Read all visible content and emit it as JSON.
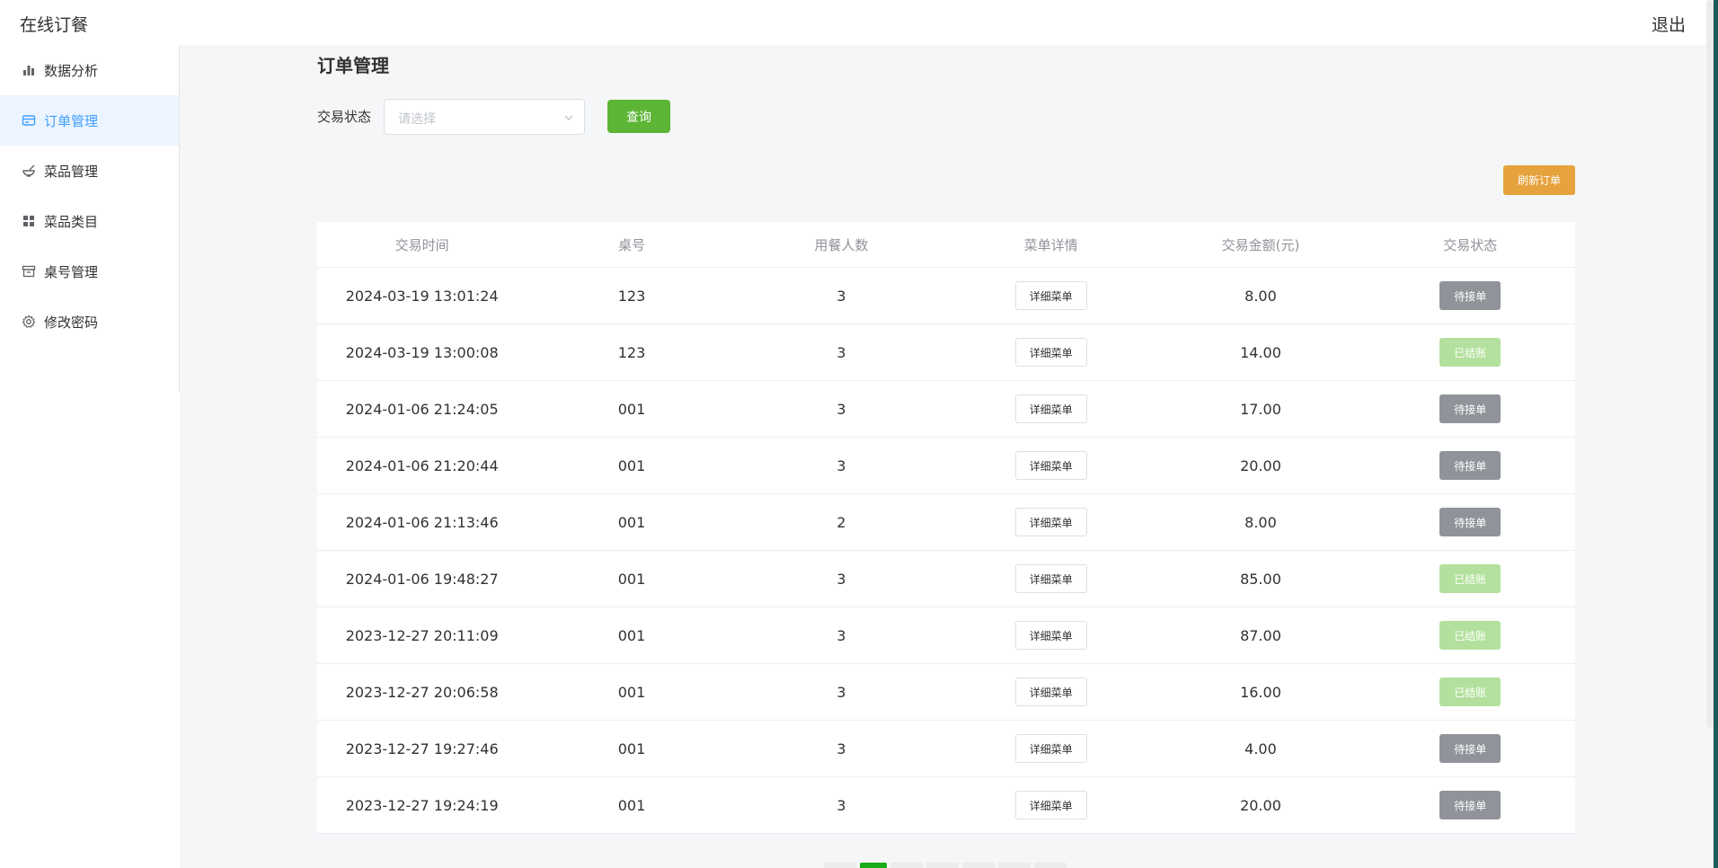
{
  "header": {
    "title": "在线订餐",
    "logout_label": "退出"
  },
  "sidebar": {
    "items": [
      {
        "label": "数据分析",
        "icon": "bar-chart-icon",
        "active": false
      },
      {
        "label": "订单管理",
        "icon": "card-icon",
        "active": true
      },
      {
        "label": "菜品管理",
        "icon": "bowl-icon",
        "active": false
      },
      {
        "label": "菜品类目",
        "icon": "grid-icon",
        "active": false
      },
      {
        "label": "桌号管理",
        "icon": "box-icon",
        "active": false
      },
      {
        "label": "修改密码",
        "icon": "gear-icon",
        "active": false
      }
    ]
  },
  "page": {
    "title": "订单管理"
  },
  "filter": {
    "label": "交易状态",
    "placeholder": "请选择",
    "query_label": "查询"
  },
  "refresh_label": "刷新订单",
  "table": {
    "headers": [
      "交易时间",
      "桌号",
      "用餐人数",
      "菜单详情",
      "交易金额(元)",
      "交易状态"
    ],
    "detail_label": "详细菜单",
    "rows": [
      {
        "time": "2024-03-19 13:01:24",
        "table": "123",
        "people": "3",
        "amount": "8.00",
        "status": "待接单",
        "status_type": "pending"
      },
      {
        "time": "2024-03-19 13:00:08",
        "table": "123",
        "people": "3",
        "amount": "14.00",
        "status": "已结账",
        "status_type": "done"
      },
      {
        "time": "2024-01-06 21:24:05",
        "table": "001",
        "people": "3",
        "amount": "17.00",
        "status": "待接单",
        "status_type": "pending"
      },
      {
        "time": "2024-01-06 21:20:44",
        "table": "001",
        "people": "3",
        "amount": "20.00",
        "status": "待接单",
        "status_type": "pending"
      },
      {
        "time": "2024-01-06 21:13:46",
        "table": "001",
        "people": "2",
        "amount": "8.00",
        "status": "待接单",
        "status_type": "pending"
      },
      {
        "time": "2024-01-06 19:48:27",
        "table": "001",
        "people": "3",
        "amount": "85.00",
        "status": "已结账",
        "status_type": "done"
      },
      {
        "time": "2023-12-27 20:11:09",
        "table": "001",
        "people": "3",
        "amount": "87.00",
        "status": "已结账",
        "status_type": "done"
      },
      {
        "time": "2023-12-27 20:06:58",
        "table": "001",
        "people": "3",
        "amount": "16.00",
        "status": "已结账",
        "status_type": "done"
      },
      {
        "time": "2023-12-27 19:27:46",
        "table": "001",
        "people": "3",
        "amount": "4.00",
        "status": "待接单",
        "status_type": "pending"
      },
      {
        "time": "2023-12-27 19:24:19",
        "table": "001",
        "people": "3",
        "amount": "20.00",
        "status": "待接单",
        "status_type": "pending"
      }
    ]
  },
  "colors": {
    "active": "#409eff",
    "query": "#5cb534",
    "refresh": "#e6a23c",
    "pending": "#909399",
    "done": "#b3e19d"
  }
}
